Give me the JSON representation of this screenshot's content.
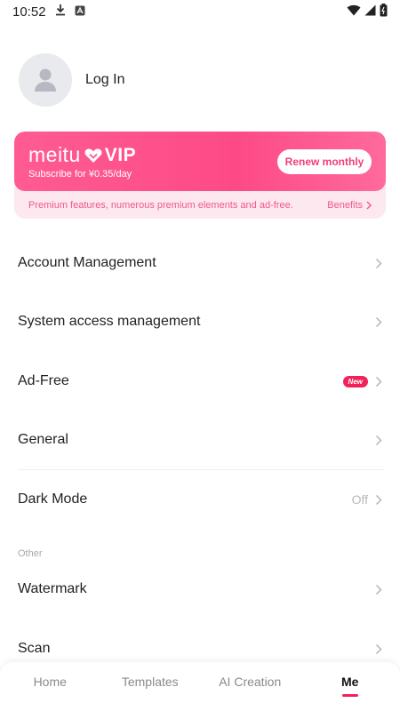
{
  "status_bar": {
    "time": "10:52"
  },
  "profile": {
    "login_label": "Log In"
  },
  "vip": {
    "brand": "meitu",
    "vip_label": "VIP",
    "subtitle": "Subscribe for ¥0.35/day",
    "renew_label": "Renew monthly",
    "features_text": "Premium features, numerous premium elements and ad-free.",
    "benefits_label": "Benefits"
  },
  "menu": {
    "account_management": "Account Management",
    "system_access": "System access management",
    "ad_free": "Ad-Free",
    "ad_free_badge": "New",
    "general": "General",
    "dark_mode": "Dark Mode",
    "dark_mode_value": "Off",
    "section_other": "Other",
    "watermark": "Watermark",
    "scan": "Scan"
  },
  "bottom_nav": {
    "home": "Home",
    "templates": "Templates",
    "ai_creation": "AI Creation",
    "me": "Me"
  },
  "colors": {
    "accent": "#f2215a",
    "vip_gradient_start": "#ff5b93",
    "vip_gradient_end": "#fd4a86",
    "vip_light_bg": "#fde8ef"
  }
}
